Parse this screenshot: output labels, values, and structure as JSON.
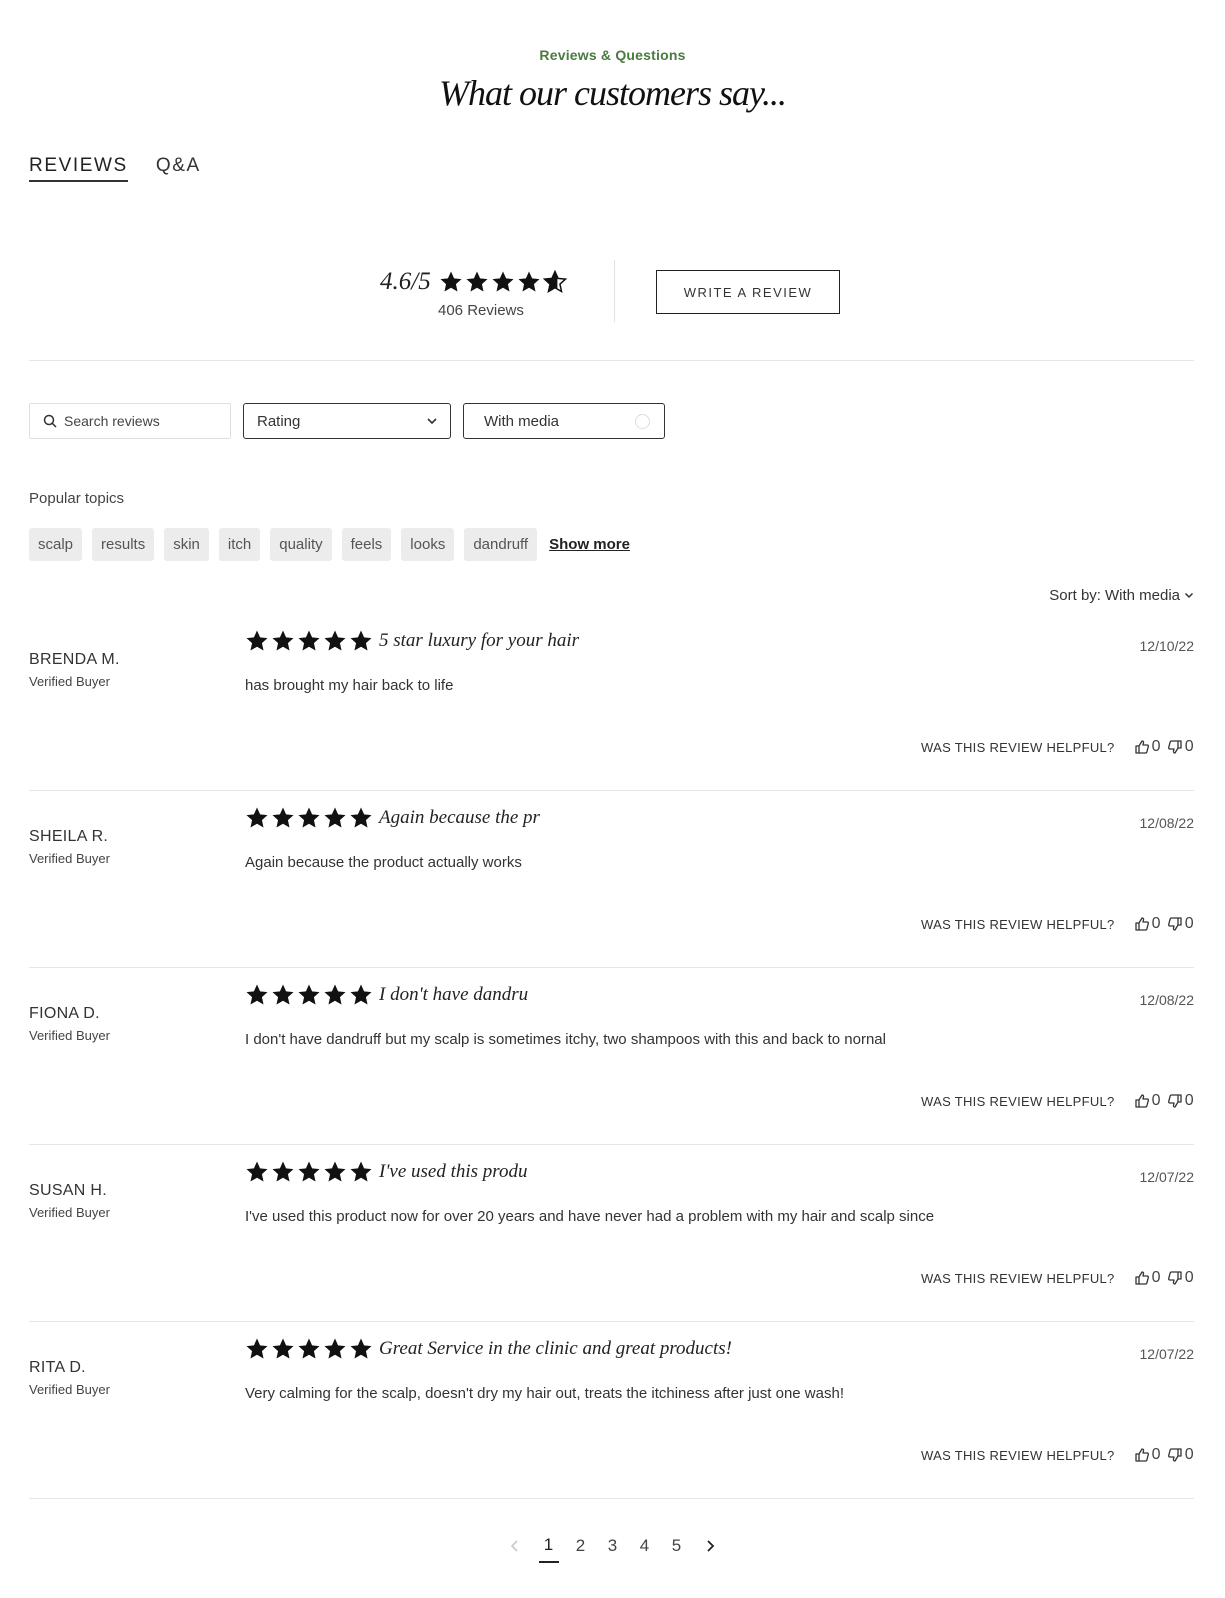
{
  "header": {
    "eyebrow": "Reviews & Questions",
    "title": "What our customers say..."
  },
  "tabs": [
    {
      "label": "REVIEWS",
      "active": true
    },
    {
      "label": "Q&A",
      "active": false
    }
  ],
  "summary": {
    "score": "4.6/5",
    "rating": 4.6,
    "count_label": "406 Reviews",
    "write_button": "WRITE A REVIEW"
  },
  "filters": {
    "search_placeholder": "Search reviews",
    "rating_label": "Rating",
    "media_label": "With media"
  },
  "topics": {
    "label": "Popular topics",
    "items": [
      "scalp",
      "results",
      "skin",
      "itch",
      "quality",
      "feels",
      "looks",
      "dandruff"
    ],
    "show_more": "Show more"
  },
  "sort": {
    "label": "Sort by:",
    "value": "With media"
  },
  "helpful_label": "WAS THIS REVIEW HELPFUL?",
  "reviews": [
    {
      "name": "BRENDA M.",
      "badge": "Verified Buyer",
      "rating": 5,
      "title": "5 star luxury for your hair",
      "date": "12/10/22",
      "body": "has brought my hair back to life",
      "up": "0",
      "down": "0"
    },
    {
      "name": "SHEILA R.",
      "badge": "Verified Buyer",
      "rating": 5,
      "title": "Again because the pr",
      "date": "12/08/22",
      "body": "Again because the product actually works",
      "up": "0",
      "down": "0"
    },
    {
      "name": "FIONA D.",
      "badge": "Verified Buyer",
      "rating": 5,
      "title": "I don't have dandru",
      "date": "12/08/22",
      "body": "I don't have dandruff but my scalp is sometimes itchy, two shampoos with this and back to nornal",
      "up": "0",
      "down": "0"
    },
    {
      "name": "SUSAN H.",
      "badge": "Verified Buyer",
      "rating": 5,
      "title": "I've used this produ",
      "date": "12/07/22",
      "body": "I've used this product now for over 20 years and have never had a problem with my hair and scalp since",
      "up": "0",
      "down": "0"
    },
    {
      "name": "RITA D.",
      "badge": "Verified Buyer",
      "rating": 5,
      "title": "Great Service in the clinic and great products!",
      "date": "12/07/22",
      "body": "Very calming for the scalp, doesn't dry my hair out, treats the itchiness after just one wash!",
      "up": "0",
      "down": "0"
    }
  ],
  "pagination": {
    "pages": [
      "1",
      "2",
      "3",
      "4",
      "5"
    ],
    "current": "1"
  }
}
